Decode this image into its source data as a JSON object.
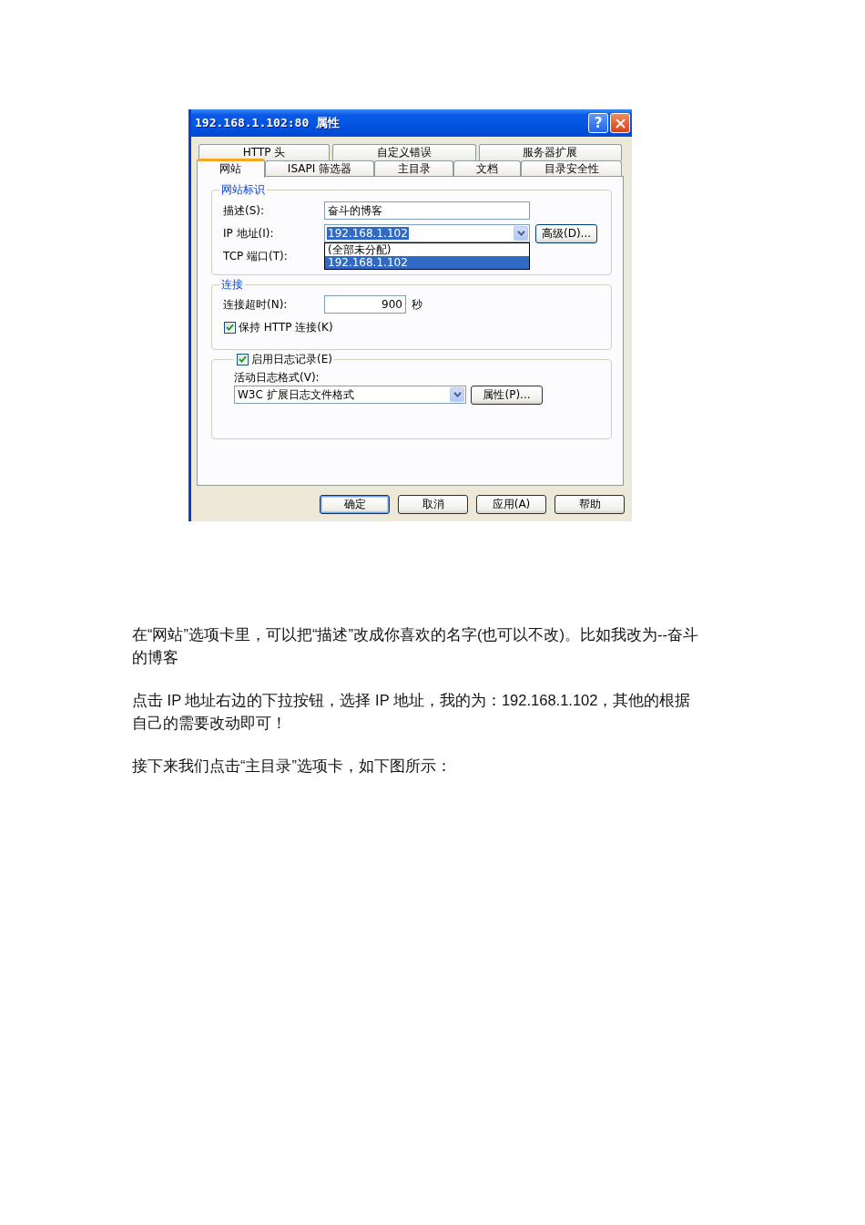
{
  "dialog": {
    "title": "192.168.1.102:80 属性",
    "title_buttons": [
      {
        "kind": "help",
        "label": "?"
      },
      {
        "kind": "close"
      }
    ],
    "tab_rows": [
      {
        "tabs": [
          {
            "label": "HTTP 头",
            "selected": false
          },
          {
            "label": "自定义错误",
            "selected": false
          },
          {
            "label": "服务器扩展",
            "selected": false
          }
        ]
      },
      {
        "tabs": [
          {
            "label": "网站",
            "selected": true
          },
          {
            "label": "ISAPI 筛选器",
            "selected": false
          },
          {
            "label": "主目录",
            "selected": false
          },
          {
            "label": "文档",
            "selected": false
          },
          {
            "label": "目录安全性",
            "selected": false
          }
        ]
      }
    ],
    "site_identification": {
      "title": "网站标识",
      "description": {
        "label": "描述(S):",
        "value": "奋斗的博客"
      },
      "ip_address": {
        "label": "IP 地址(I):",
        "value": "192.168.1.102",
        "highlighted": true,
        "expanded": true,
        "options": [
          {
            "label": "(全部未分配)",
            "selected": false
          },
          {
            "label": "192.168.1.102",
            "selected": true
          }
        ]
      },
      "advanced_button": "高级(D)...",
      "tcp_port": {
        "label": "TCP 端口(T):"
      }
    },
    "connection": {
      "title": "连接",
      "timeout": {
        "label": "连接超时(N):",
        "value": "900",
        "unit": "秒"
      },
      "keep_alive": {
        "label": "保持 HTTP 连接(K)",
        "checked": true
      }
    },
    "logging": {
      "enable": {
        "label": "启用日志记录(E)",
        "checked": true
      },
      "format": {
        "label": "活动日志格式(V):",
        "value": "W3C 扩展日志文件格式"
      },
      "properties_button": "属性(P)..."
    },
    "buttons": [
      {
        "label": "确定",
        "default": true
      },
      {
        "label": "取消",
        "default": false
      },
      {
        "label": "应用(A)",
        "default": false
      },
      {
        "label": "帮助",
        "default": false
      }
    ]
  },
  "article": {
    "paragraphs": [
      "在“网站”选项卡里，可以把“描述”改成你喜欢的名字(也可以不改)。比如我改为--奋斗的博客",
      "点击 IP 地址右边的下拉按钮，选择 IP 地址，我的为：192.168.1.102，其他的根据自己的需要改动即可！",
      "接下来我们点击“主目录”选项卡，如下图所示："
    ]
  }
}
